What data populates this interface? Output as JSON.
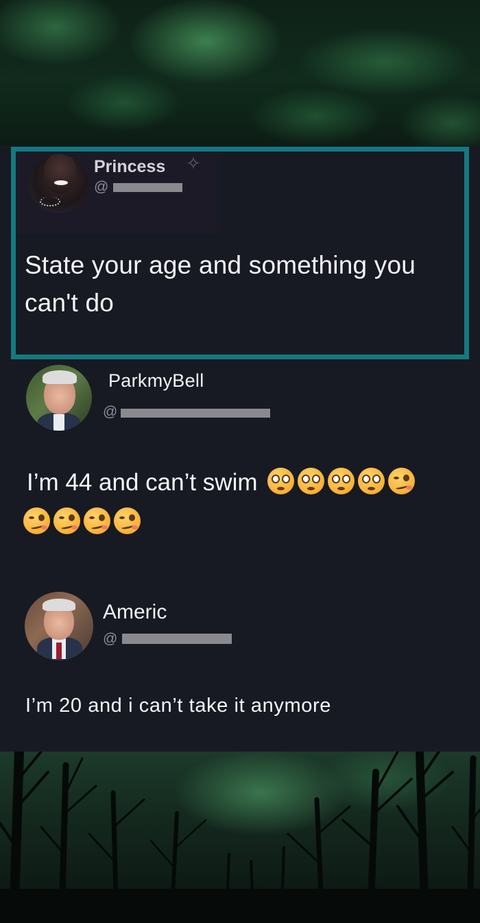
{
  "op": {
    "name": "Princess",
    "handle_prefix": "@",
    "text": "State your age and something you can't do"
  },
  "replies": [
    {
      "name": "ParkmyBell",
      "handle_prefix": "@",
      "text": "I’m 44 and can’t swim",
      "emojis": [
        "flushed-face",
        "flushed-face",
        "flushed-face",
        "flushed-face",
        "woozy-face",
        "woozy-face",
        "woozy-face",
        "woozy-face",
        "woozy-face"
      ]
    },
    {
      "name": "Americ",
      "handle_prefix": "@",
      "text": "I’m 20 and i can’t take it anymore"
    }
  ],
  "colors": {
    "highlight_border": "#15797f",
    "card_background": "#171a23"
  }
}
